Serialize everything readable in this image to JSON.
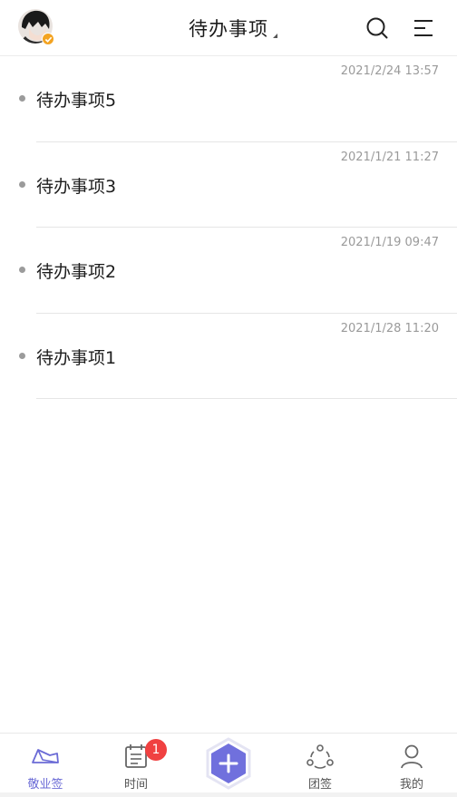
{
  "header": {
    "title": "待办事项",
    "avatar_icon": "user-avatar",
    "search_icon": "search-icon",
    "menu_icon": "menu-icon"
  },
  "todos": [
    {
      "label": "待办事项5",
      "time": "2021/2/24 13:57"
    },
    {
      "label": "待办事项3",
      "time": "2021/1/21 11:27"
    },
    {
      "label": "待办事项2",
      "time": "2021/1/19 09:47"
    },
    {
      "label": "待办事项1",
      "time": "2021/1/28 11:20"
    }
  ],
  "tabbar": {
    "home_label": "敬业签",
    "time_label": "时间",
    "time_badge": "1",
    "team_label": "团签",
    "me_label": "我的",
    "add_icon": "add-icon"
  },
  "colors": {
    "accent": "#6b6bd6",
    "badge": "#f04141",
    "vip_badge": "#f3a321"
  }
}
